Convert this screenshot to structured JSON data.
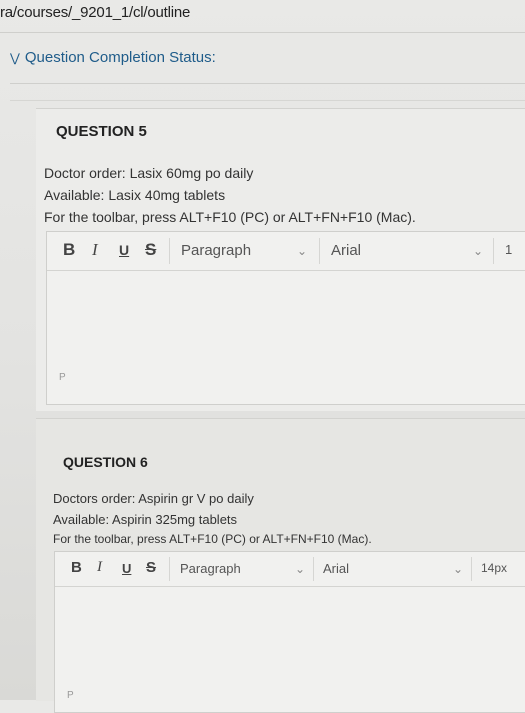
{
  "url_fragment": "ra/courses/_9201_1/cl/outline",
  "status": {
    "label": "Question Completion Status:"
  },
  "questions": [
    {
      "title": "QUESTION 5",
      "lines": [
        "Doctor order:  Lasix 60mg po daily",
        "Available:  Lasix 40mg tablets",
        "For the toolbar, press ALT+F10 (PC) or ALT+FN+F10 (Mac)."
      ],
      "toolbar": {
        "bold": "B",
        "italic": "I",
        "underline": "U",
        "strike": "S",
        "paragraph": "Paragraph",
        "font": "Arial",
        "size": "1"
      },
      "path_label": "P"
    },
    {
      "title": "QUESTION 6",
      "lines": [
        "Doctors order:  Aspirin gr V po daily",
        "Available:  Aspirin 325mg tablets",
        "For the toolbar, press ALT+F10 (PC) or ALT+FN+F10 (Mac)."
      ],
      "toolbar": {
        "bold": "B",
        "italic": "I",
        "underline": "U",
        "strike": "S",
        "paragraph": "Paragraph",
        "font": "Arial",
        "size": "14px"
      },
      "path_label": "P"
    }
  ],
  "icons": {
    "collapse": "chevron-down-double-icon",
    "select_arrow": "chevron-down-icon"
  }
}
